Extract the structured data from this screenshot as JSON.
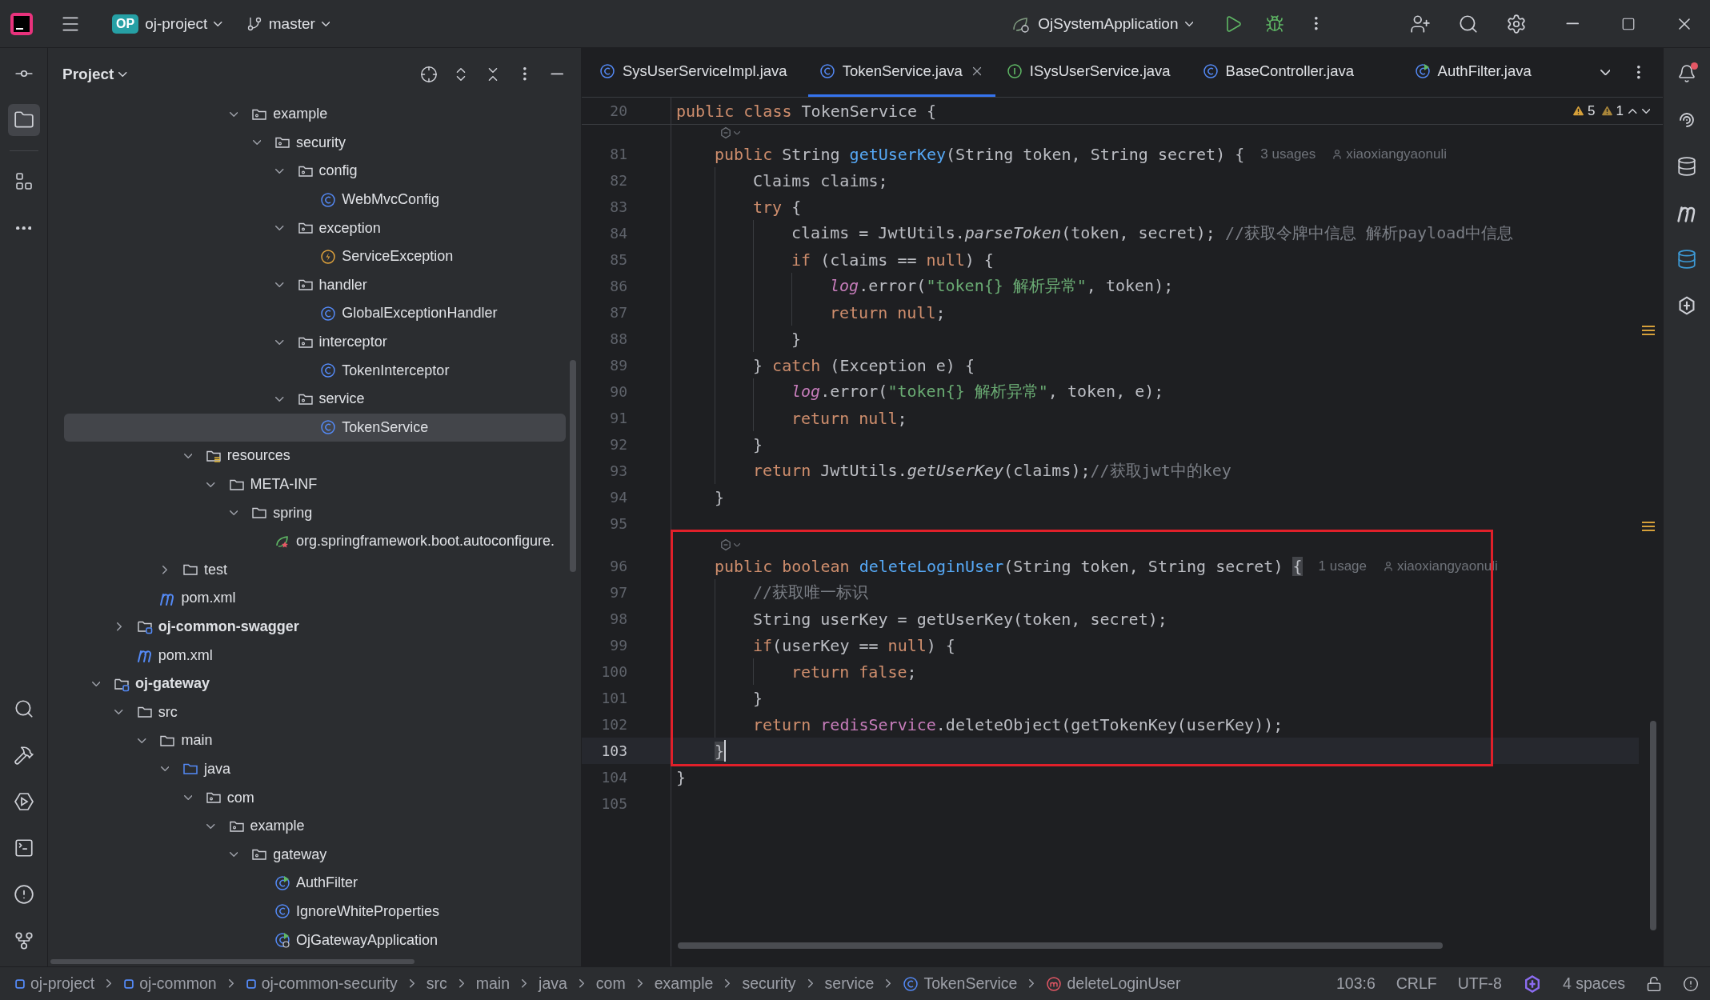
{
  "title_bar": {
    "project_badge": "OP",
    "project": "oj-project",
    "branch": "master",
    "run_config": "OjSystemApplication"
  },
  "project_panel": {
    "title": "Project",
    "tree": [
      {
        "label": "example",
        "kind": "package",
        "expanded": true,
        "selected": false,
        "children": [
          {
            "label": "security",
            "kind": "package",
            "expanded": true,
            "selected": false,
            "children": [
              {
                "label": "config",
                "kind": "package",
                "expanded": true,
                "selected": false,
                "children": [
                  {
                    "label": "WebMvcConfig",
                    "kind": "class",
                    "selected": false
                  }
                ]
              },
              {
                "label": "exception",
                "kind": "package",
                "expanded": true,
                "selected": false,
                "children": [
                  {
                    "label": "ServiceException",
                    "kind": "exception",
                    "selected": false
                  }
                ]
              },
              {
                "label": "handler",
                "kind": "package",
                "expanded": true,
                "selected": false,
                "children": [
                  {
                    "label": "GlobalExceptionHandler",
                    "kind": "class",
                    "selected": false
                  }
                ]
              },
              {
                "label": "interceptor",
                "kind": "package",
                "expanded": true,
                "selected": false,
                "children": [
                  {
                    "label": "TokenInterceptor",
                    "kind": "class",
                    "selected": false
                  }
                ]
              },
              {
                "label": "service",
                "kind": "package",
                "expanded": true,
                "selected": false,
                "children": [
                  {
                    "label": "TokenService",
                    "kind": "class",
                    "selected": true
                  }
                ]
              }
            ]
          }
        ]
      },
      {
        "label": "resources",
        "kind": "resources",
        "expanded": true,
        "selected": false,
        "children": [
          {
            "label": "META-INF",
            "kind": "folder",
            "expanded": true,
            "selected": false,
            "children": [
              {
                "label": "spring",
                "kind": "folder",
                "expanded": true,
                "selected": false,
                "children": [
                  {
                    "label": "org.springframework.boot.autoconfigure.",
                    "kind": "spring_file",
                    "selected": false
                  }
                ]
              }
            ]
          }
        ]
      },
      {
        "label": "test",
        "kind": "folder",
        "expanded": false,
        "selected": false
      },
      {
        "label": "pom.xml",
        "kind": "maven",
        "selected": false
      },
      {
        "label": "oj-common-swagger",
        "kind": "module",
        "expanded": false,
        "selected": false
      },
      {
        "label": "pom.xml",
        "kind": "maven",
        "selected": false
      },
      {
        "label": "oj-gateway",
        "kind": "module",
        "expanded": true,
        "selected": false,
        "children": [
          {
            "label": "src",
            "kind": "folder",
            "expanded": true,
            "selected": false,
            "children": [
              {
                "label": "main",
                "kind": "folder",
                "expanded": true,
                "selected": false,
                "children": [
                  {
                    "label": "java",
                    "kind": "source_root",
                    "expanded": true,
                    "selected": false,
                    "children": [
                      {
                        "label": "com",
                        "kind": "package",
                        "expanded": true,
                        "selected": false,
                        "children": [
                          {
                            "label": "example",
                            "kind": "package",
                            "expanded": true,
                            "selected": false,
                            "children": [
                              {
                                "label": "gateway",
                                "kind": "package",
                                "expanded": true,
                                "selected": false,
                                "children": [
                                  {
                                    "label": "AuthFilter",
                                    "kind": "bean",
                                    "selected": false
                                  },
                                  {
                                    "label": "IgnoreWhiteProperties",
                                    "kind": "class",
                                    "selected": false
                                  },
                                  {
                                    "label": "OjGatewayApplication",
                                    "kind": "app",
                                    "selected": false
                                  }
                                ]
                              }
                            ]
                          }
                        ]
                      }
                    ]
                  }
                ]
              }
            ]
          }
        ]
      }
    ]
  },
  "tabs": [
    {
      "label": "SysUserServiceImpl.java",
      "kind": "class",
      "selected": false
    },
    {
      "label": "TokenService.java",
      "kind": "class",
      "selected": true
    },
    {
      "label": "ISysUserService.java",
      "kind": "interface",
      "selected": false
    },
    {
      "label": "BaseController.java",
      "kind": "class",
      "selected": false
    },
    {
      "label": "AuthFilter.java",
      "kind": "bean",
      "selected": false
    }
  ],
  "editor": {
    "sticky_line": {
      "number": "20",
      "tokens": [
        {
          "kind": "kw",
          "text": "public class "
        },
        {
          "kind": "plain",
          "text": "TokenService {"
        }
      ]
    },
    "inspections": {
      "warnings": "5",
      "weak_warnings": "1"
    },
    "lines": [
      {
        "kind": "lens"
      },
      {
        "kind": "code",
        "number": "81",
        "current": false,
        "tokens": [
          {
            "kind": "kw",
            "text": "    public "
          },
          {
            "kind": "plain",
            "text": "String "
          },
          {
            "kind": "decl",
            "text": "getUserKey"
          },
          {
            "kind": "plain",
            "text": "(String token, String secret) {"
          }
        ],
        "hints": {
          "usages": "3 usages",
          "author": "xiaoxiangyaonuli"
        }
      },
      {
        "kind": "code",
        "number": "82",
        "current": false,
        "tokens": [
          {
            "kind": "plain",
            "text": "        Claims claims;"
          }
        ]
      },
      {
        "kind": "code",
        "number": "83",
        "current": false,
        "tokens": [
          {
            "kind": "kw",
            "text": "        try "
          },
          {
            "kind": "plain",
            "text": "{"
          }
        ]
      },
      {
        "kind": "code",
        "number": "84",
        "current": false,
        "tokens": [
          {
            "kind": "plain",
            "text": "            claims = JwtUtils."
          },
          {
            "kind": "static",
            "text": "parseToken"
          },
          {
            "kind": "plain",
            "text": "(token, secret); "
          },
          {
            "kind": "comment",
            "text": "//获取令牌中信息 解析payload中信息"
          }
        ]
      },
      {
        "kind": "code",
        "number": "85",
        "current": false,
        "tokens": [
          {
            "kind": "kw",
            "text": "            if "
          },
          {
            "kind": "plain",
            "text": "(claims == "
          },
          {
            "kind": "kw",
            "text": "null"
          },
          {
            "kind": "plain",
            "text": ") {"
          }
        ]
      },
      {
        "kind": "code",
        "number": "86",
        "current": false,
        "tokens": [
          {
            "kind": "static_field",
            "text": "                log"
          },
          {
            "kind": "plain",
            "text": ".error("
          },
          {
            "kind": "str",
            "text": "\"token{} 解析异常\""
          },
          {
            "kind": "plain",
            "text": ", token);"
          }
        ]
      },
      {
        "kind": "code",
        "number": "87",
        "current": false,
        "tokens": [
          {
            "kind": "kw",
            "text": "                return null"
          },
          {
            "kind": "plain",
            "text": ";"
          }
        ]
      },
      {
        "kind": "code",
        "number": "88",
        "current": false,
        "tokens": [
          {
            "kind": "plain",
            "text": "            }"
          }
        ]
      },
      {
        "kind": "code",
        "number": "89",
        "current": false,
        "tokens": [
          {
            "kind": "plain",
            "text": "        } "
          },
          {
            "kind": "kw",
            "text": "catch "
          },
          {
            "kind": "plain",
            "text": "(Exception e) {"
          }
        ]
      },
      {
        "kind": "code",
        "number": "90",
        "current": false,
        "tokens": [
          {
            "kind": "static_field",
            "text": "            log"
          },
          {
            "kind": "plain",
            "text": ".error("
          },
          {
            "kind": "str",
            "text": "\"token{} 解析异常\""
          },
          {
            "kind": "plain",
            "text": ", token, e);"
          }
        ]
      },
      {
        "kind": "code",
        "number": "91",
        "current": false,
        "tokens": [
          {
            "kind": "kw",
            "text": "            return null"
          },
          {
            "kind": "plain",
            "text": ";"
          }
        ]
      },
      {
        "kind": "code",
        "number": "92",
        "current": false,
        "tokens": [
          {
            "kind": "plain",
            "text": "        }"
          }
        ]
      },
      {
        "kind": "code",
        "number": "93",
        "current": false,
        "tokens": [
          {
            "kind": "kw",
            "text": "        return "
          },
          {
            "kind": "plain",
            "text": "JwtUtils."
          },
          {
            "kind": "static",
            "text": "getUserKey"
          },
          {
            "kind": "plain",
            "text": "(claims);"
          },
          {
            "kind": "comment",
            "text": "//获取jwt中的key"
          }
        ]
      },
      {
        "kind": "code",
        "number": "94",
        "current": false,
        "tokens": [
          {
            "kind": "plain",
            "text": "    }"
          }
        ]
      },
      {
        "kind": "code",
        "number": "95",
        "current": false
      },
      {
        "kind": "annotated_block",
        "lines": [
          {
            "kind": "lens"
          },
          {
            "kind": "code",
            "number": "96",
            "current": false,
            "tokens": [
              {
                "kind": "kw",
                "text": "    public boolean "
              },
              {
                "kind": "decl",
                "text": "deleteLoginUser"
              },
              {
                "kind": "plain",
                "text": "(String token, String secret) "
              },
              {
                "kind": "match",
                "text": "{"
              }
            ],
            "hints": {
              "usages": "1 usage",
              "author": "xiaoxiangyaonuli"
            }
          },
          {
            "kind": "code",
            "number": "97",
            "current": false,
            "tokens": [
              {
                "kind": "comment",
                "text": "        //获取唯一标识"
              }
            ]
          },
          {
            "kind": "code",
            "number": "98",
            "current": false,
            "tokens": [
              {
                "kind": "plain",
                "text": "        String userKey = getUserKey(token, secret);"
              }
            ]
          },
          {
            "kind": "code",
            "number": "99",
            "current": false,
            "tokens": [
              {
                "kind": "kw",
                "text": "        if"
              },
              {
                "kind": "plain",
                "text": "(userKey == "
              },
              {
                "kind": "kw",
                "text": "null"
              },
              {
                "kind": "plain",
                "text": ") {"
              }
            ]
          },
          {
            "kind": "code",
            "number": "100",
            "current": false,
            "tokens": [
              {
                "kind": "kw",
                "text": "            return false"
              },
              {
                "kind": "plain",
                "text": ";"
              }
            ]
          },
          {
            "kind": "code",
            "number": "101",
            "current": false,
            "tokens": [
              {
                "kind": "plain",
                "text": "        }"
              }
            ]
          },
          {
            "kind": "code",
            "number": "102",
            "current": false,
            "tokens": [
              {
                "kind": "kw",
                "text": "        return "
              },
              {
                "kind": "field",
                "text": "redisService"
              },
              {
                "kind": "plain",
                "text": ".deleteObject(getTokenKey(userKey));"
              }
            ]
          },
          {
            "kind": "code",
            "number": "103",
            "current": true,
            "tokens": [
              {
                "kind": "match",
                "text": "    }"
              }
            ]
          }
        ]
      },
      {
        "kind": "code",
        "number": "104",
        "current": false,
        "tokens": [
          {
            "kind": "plain",
            "text": "}"
          }
        ]
      },
      {
        "kind": "code",
        "number": "105",
        "current": false
      }
    ]
  },
  "breadcrumbs": [
    {
      "label": "oj-project",
      "kind": "module"
    },
    {
      "label": "oj-common",
      "kind": "module"
    },
    {
      "label": "oj-common-security",
      "kind": "module"
    },
    {
      "label": "src",
      "kind": "dir"
    },
    {
      "label": "main",
      "kind": "dir"
    },
    {
      "label": "java",
      "kind": "dir"
    },
    {
      "label": "com",
      "kind": "dir"
    },
    {
      "label": "example",
      "kind": "dir"
    },
    {
      "label": "security",
      "kind": "dir"
    },
    {
      "label": "service",
      "kind": "dir"
    },
    {
      "label": "TokenService",
      "kind": "class"
    },
    {
      "label": "deleteLoginUser",
      "kind": "method"
    }
  ],
  "status": {
    "position": "103:6",
    "line_separator": "CRLF",
    "encoding": "UTF-8",
    "indent": "4 spaces"
  }
}
